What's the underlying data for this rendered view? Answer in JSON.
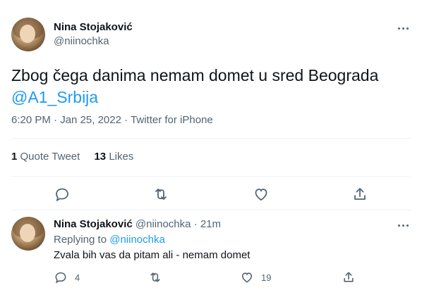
{
  "main_tweet": {
    "author_name": "Nina Stojaković",
    "author_handle": "@niinochka",
    "text": "Zbog čega danima nemam domet u sred Beograda",
    "mention": "@A1_Srbija",
    "time": "6:20 PM",
    "separator": " · ",
    "date": "Jan 25, 2022",
    "client": "Twitter for iPhone",
    "stats": {
      "quote_count": "1",
      "quote_label": "Quote Tweet",
      "like_count": "13",
      "like_label": "Likes"
    }
  },
  "reply": {
    "author_name": "Nina Stojaković",
    "author_handle": "@niinochka",
    "dot": "·",
    "time_ago": "21m",
    "replying_prefix": "Replying to",
    "replying_handle": "@niinochka",
    "text": "Zvala bih vas da pitam ali - nemam domet",
    "reply_count": "4",
    "like_count": "19"
  },
  "icons": {
    "more": "more-horizontal-icon",
    "reply": "reply-icon",
    "retweet": "retweet-icon",
    "like": "heart-icon",
    "share": "share-icon"
  },
  "colors": {
    "text": "#0f1419",
    "secondary": "#536471",
    "link": "#1d9bf0",
    "divider": "#eff3f4"
  }
}
